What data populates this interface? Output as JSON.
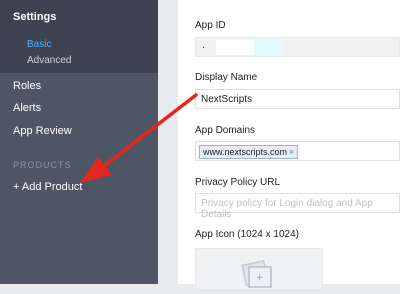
{
  "sidebar": {
    "section_title": "Settings",
    "sub_items": [
      {
        "label": "Basic"
      },
      {
        "label": "Advanced"
      }
    ],
    "items": [
      {
        "label": "Roles"
      },
      {
        "label": "Alerts"
      },
      {
        "label": "App Review"
      }
    ],
    "products_heading": "PRODUCTS",
    "add_product": "+ Add Product"
  },
  "form": {
    "app_id": {
      "label": "App ID",
      "value_left": "·",
      "value_right": ")"
    },
    "display_name": {
      "label": "Display Name",
      "value": "NextScripts"
    },
    "app_domains": {
      "label": "App Domains",
      "token": "www.nextscripts.com",
      "remove_glyph": "×"
    },
    "privacy_url": {
      "label": "Privacy Policy URL",
      "placeholder": "Privacy policy for Login dialog and App Details"
    },
    "app_icon": {
      "label": "App Icon (1024 x 1024)"
    }
  },
  "colors": {
    "sidebar_bg": "#4e5665",
    "active_bg": "#3d4350",
    "accent": "#4fb0ff",
    "arrow": "#e5261f"
  }
}
